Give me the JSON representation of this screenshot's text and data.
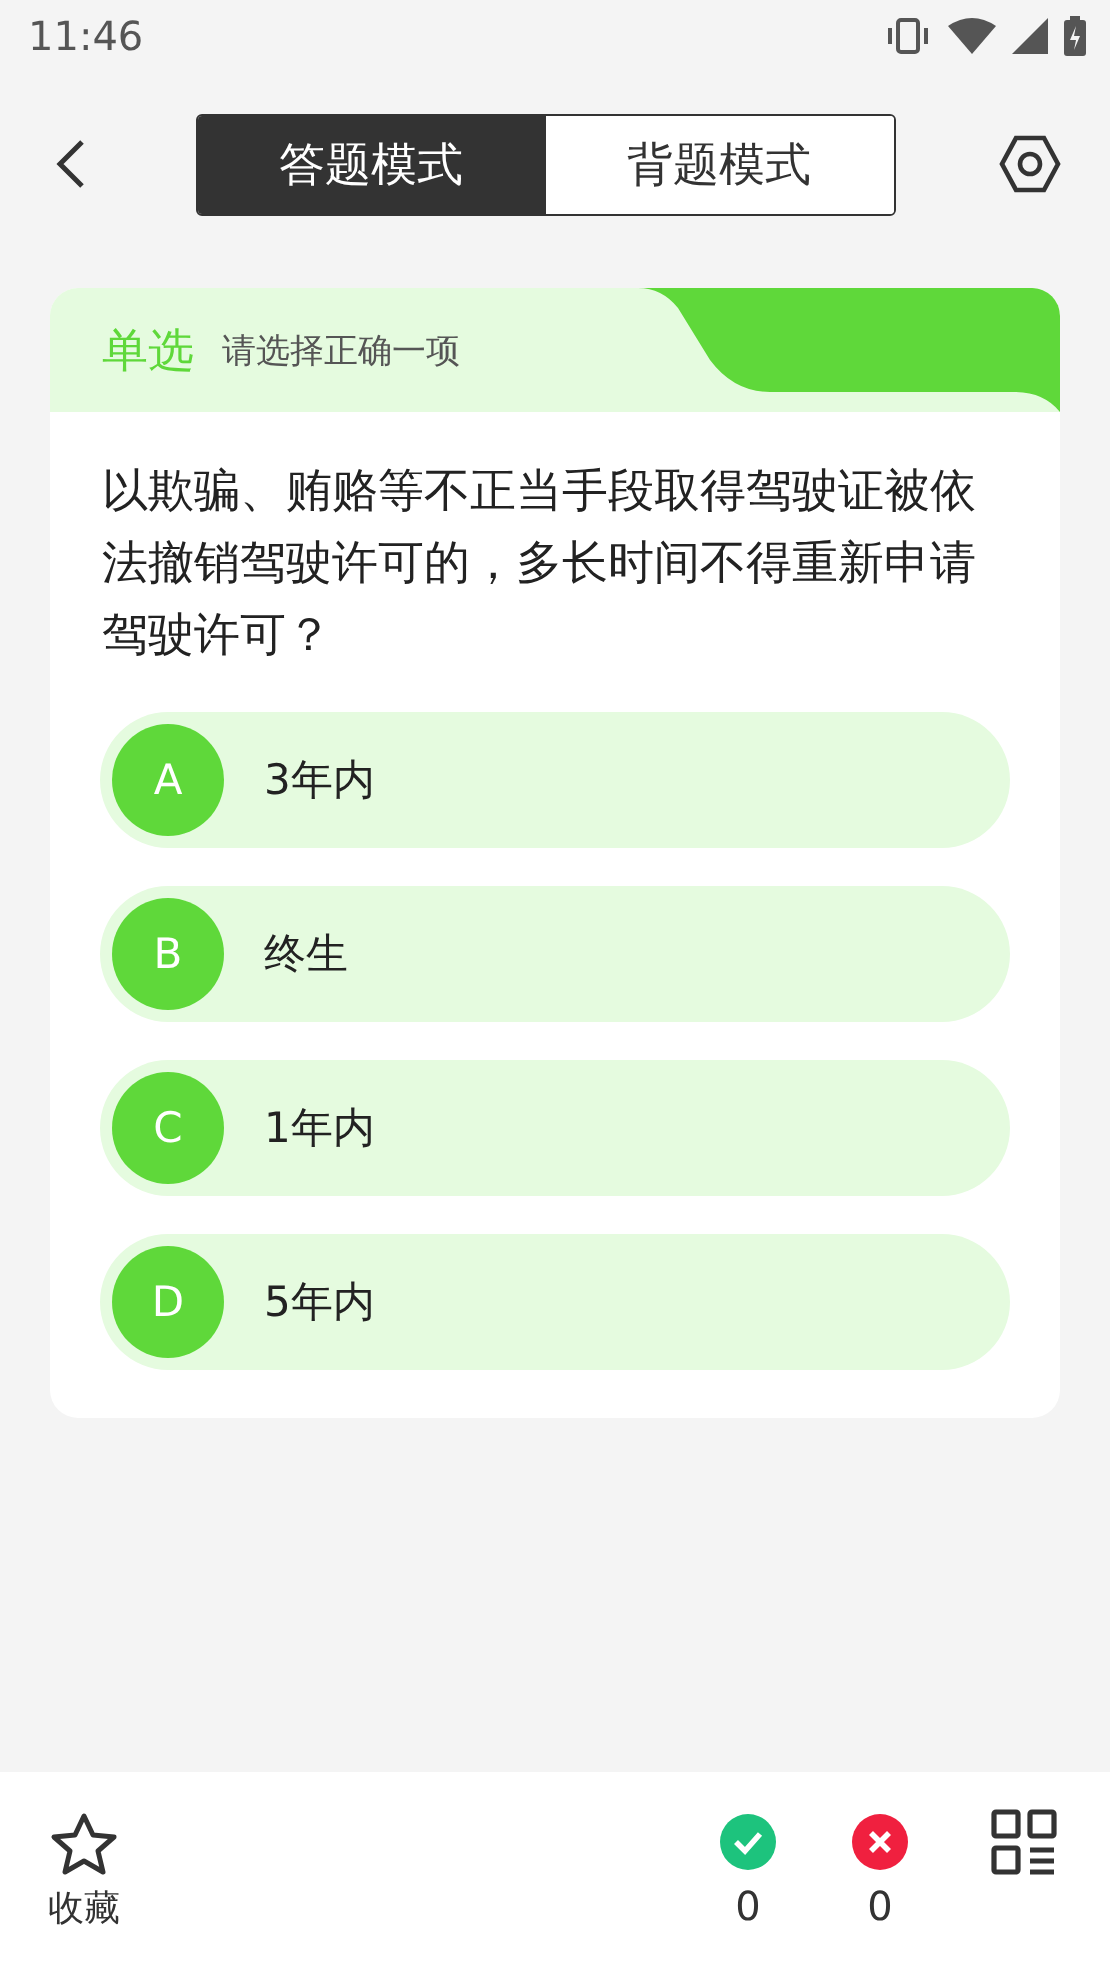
{
  "status_bar": {
    "time": "11:46"
  },
  "mode_tabs": [
    {
      "label": "答题模式",
      "selected": true
    },
    {
      "label": "背题模式",
      "selected": false
    }
  ],
  "question": {
    "type": "单选",
    "hint": "请选择正确一项",
    "text": "以欺骗、贿赂等不正当手段取得驾驶证被依法撤销驾驶许可的，多长时间不得重新申请驾驶许可？",
    "options": [
      {
        "letter": "A",
        "text": "3年内",
        "selected": false
      },
      {
        "letter": "B",
        "text": "终生",
        "selected": false
      },
      {
        "letter": "C",
        "text": "1年内",
        "selected": false
      },
      {
        "letter": "D",
        "text": "5年内",
        "selected": false
      }
    ]
  },
  "bottom_bar": {
    "favorite_label": "收藏",
    "correct_count": "0",
    "wrong_count": "0"
  }
}
